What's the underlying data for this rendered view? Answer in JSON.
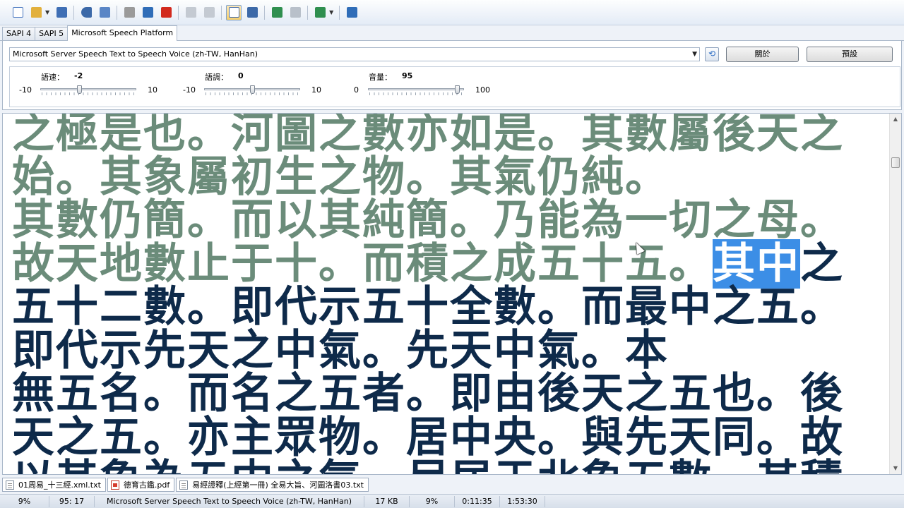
{
  "toolbar": {
    "buttons": [
      {
        "name": "new-document-icon",
        "color": "#4a78c0"
      },
      {
        "name": "open-folder-icon",
        "color": "#e2b03c"
      },
      {
        "name": "save-icon",
        "color": "#3f6fb5"
      },
      {
        "name": "speak-icon",
        "color": "#3c69a8"
      },
      {
        "name": "speak-to-file-icon",
        "color": "#3c69a8"
      },
      {
        "name": "play-icon",
        "color": "#8a8a8a"
      },
      {
        "name": "pause-icon",
        "color": "#2f6db8"
      },
      {
        "name": "stop-icon",
        "color": "#d22a1e"
      },
      {
        "name": "copy-icon",
        "color": "#9aa4b0"
      },
      {
        "name": "paste-icon",
        "color": "#9aa4b0"
      },
      {
        "name": "text-view-icon",
        "color": "#4a6fa8",
        "active": true
      },
      {
        "name": "font-icon",
        "color": "#3c69a8"
      },
      {
        "name": "split-icon",
        "color": "#2f8f4f"
      },
      {
        "name": "join-icon",
        "color": "#9aa4b0"
      },
      {
        "name": "tools-icon",
        "color": "#2f8f4f"
      },
      {
        "name": "help-icon",
        "color": "#2f6db8"
      }
    ]
  },
  "tabs": [
    {
      "label": "SAPI 4"
    },
    {
      "label": "SAPI 5"
    },
    {
      "label": "Microsoft Speech Platform"
    }
  ],
  "voice": {
    "selected": "Microsoft Server Speech Text to Speech Voice (zh-TW, HanHan)",
    "about_label": "關於",
    "default_label": "預設"
  },
  "sliders": {
    "rate": {
      "label": "語速：",
      "value": "-2",
      "min": "-10",
      "max": "10",
      "fraction": 0.4
    },
    "pitch": {
      "label": "語調：",
      "value": "0",
      "min": "-10",
      "max": "10",
      "fraction": 0.5
    },
    "volume": {
      "label": "音量：",
      "value": "95",
      "min": "0",
      "max": "100",
      "fraction": 0.95
    }
  },
  "document": {
    "read_text": "之極是也。河圖之數亦如是。其數屬後天之\n始。其象屬初生之物。其氣仍純。\n其數仍簡。而以其純簡。乃能為一切之母。\n故天地數止于十。而積之成五十五。",
    "highlight_text": "其中",
    "unread_text": "之\n五十二數。即代示五十全數。而最中之五。\n即代示先天之中氣。先天中氣。本\n無五名。而名之五者。即由後天之五也。後\n天之五。亦主眾物。居中央。與先天同。故\n以其象為五中之氣。尽居于北象五數。其積"
  },
  "files": [
    {
      "name": "01周易_十三經.xml.txt",
      "type": "txt"
    },
    {
      "name": "德育古鑑.pdf",
      "type": "pdf"
    },
    {
      "name": "易經證釋(上經第一冊) 全易大旨、河圖洛書03.txt",
      "type": "txt"
    }
  ],
  "status": {
    "progress": "9%",
    "position": "95: 17",
    "voice": "Microsoft Server Speech Text to Speech Voice (zh-TW, HanHan)",
    "size": "17 KB",
    "percent": "9%",
    "elapsed": "0:11:35",
    "total": "1:53:30"
  }
}
